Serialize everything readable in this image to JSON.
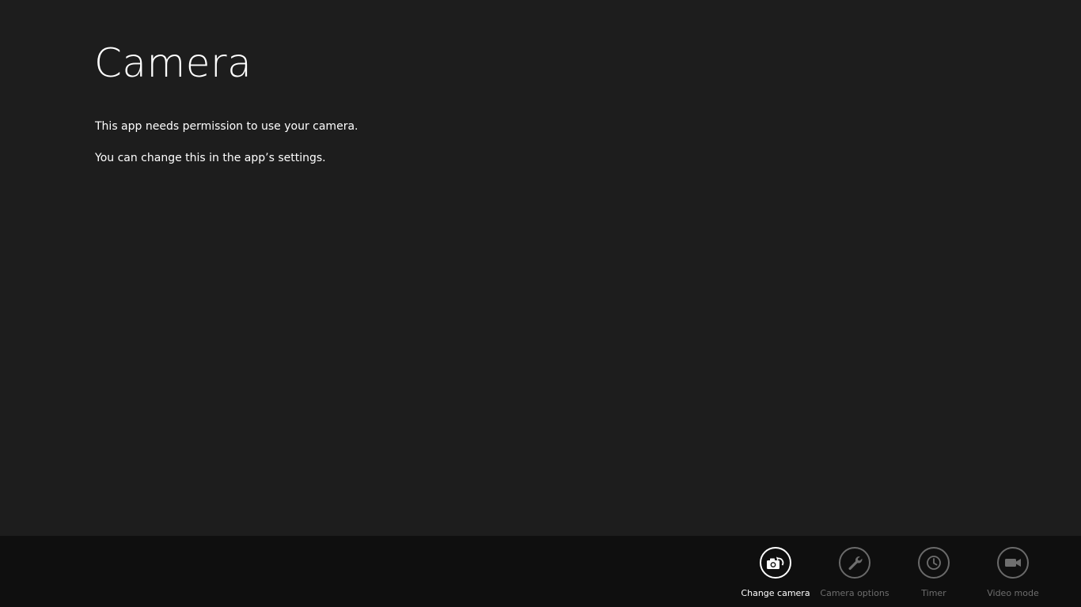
{
  "page": {
    "title": "Camera",
    "messages": [
      "This app needs permission to use your camera.",
      "You can change this in the app’s settings."
    ]
  },
  "app_bar": {
    "buttons": [
      {
        "label": "Change camera",
        "icon": "camera-switch-icon",
        "state": "enabled"
      },
      {
        "label": "Camera options",
        "icon": "wrench-icon",
        "state": "disabled"
      },
      {
        "label": "Timer",
        "icon": "clock-icon",
        "state": "disabled"
      },
      {
        "label": "Video mode",
        "icon": "video-camera-icon",
        "state": "disabled"
      }
    ]
  },
  "colors": {
    "background": "#1d1d1d",
    "app_bar": "#0f0f0f",
    "text": "#ffffff",
    "disabled": "#6e6e6e"
  }
}
